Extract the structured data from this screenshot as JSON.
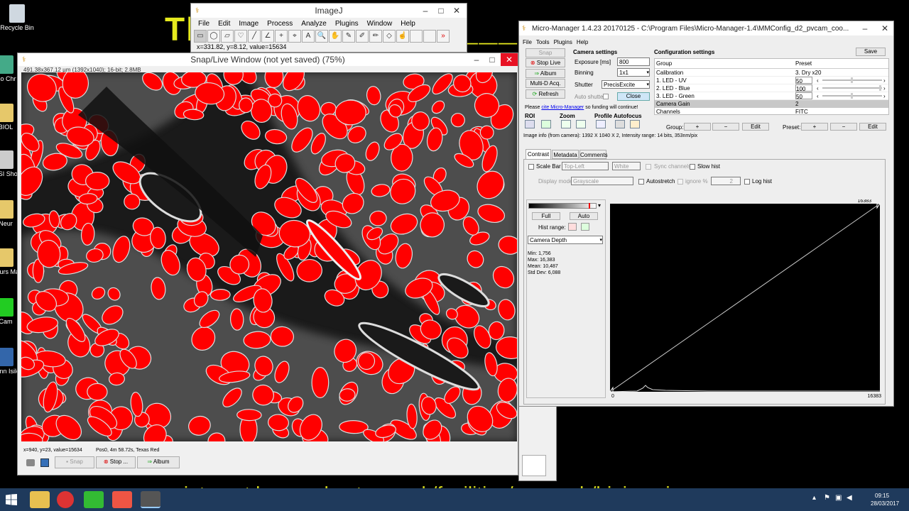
{
  "banner": {
    "top_text": "Thr__ ___ ___ __ ___ ____ ___",
    "bottom_text": "www.intranet.ls.manchester.ac.uk/facilities/research/bioimaging"
  },
  "desktop": {
    "icons": [
      {
        "label": "Recycle Bin"
      },
      {
        "label": "Go Chr"
      },
      {
        "label": "BIOL"
      },
      {
        "label": "RSI Sho"
      },
      {
        "label": "Neur"
      },
      {
        "label": "Thurs Ma"
      },
      {
        "label": "Cam"
      },
      {
        "label": "Conn Isilo"
      }
    ]
  },
  "imagej": {
    "title": "ImageJ",
    "menu": [
      "File",
      "Edit",
      "Image",
      "Process",
      "Analyze",
      "Plugins",
      "Window",
      "Help"
    ],
    "status": "x=331.82, y=8.12, value=15634",
    "tools": [
      "rectangle-tool",
      "oval-tool",
      "polygon-tool",
      "freehand-tool",
      "line-tool",
      "angle-tool",
      "point-tool",
      "wand-tool",
      "text-tool",
      "zoom-tool",
      "hand-tool",
      "dropper-tool",
      "pencil-tool",
      "brush-tool",
      "eraser-tool",
      "hand2-tool",
      "blank1",
      "blank2",
      "more-tool"
    ]
  },
  "snap": {
    "title": "Snap/Live Window (not yet saved) (75%)",
    "info": "491.38x367.12 µm (1392x1040); 16-bit; 2.8MB",
    "status_xy": "x=940, y=23, value=15634",
    "status_pos": "Pos0, 4m 58.72s, Texas Red",
    "buttons": {
      "snap": "Snap",
      "stop": "Stop ...",
      "album": "Album"
    }
  },
  "mm": {
    "title": "Micro-Manager 1.4.23 20170125 - C:\\Program Files\\Micro-Manager-1.4\\MMConfig_d2_pvcam_coo...",
    "menu": [
      "File",
      "Tools",
      "Plugins",
      "Help"
    ],
    "left_buttons": {
      "snap": "Snap",
      "stop_live": "Stop Live",
      "album": "Album",
      "multi_d": "Multi-D Acq.",
      "refresh": "Refresh"
    },
    "camera": {
      "heading": "Camera settings",
      "exposure_label": "Exposure [ms]",
      "exposure_value": "800",
      "binning_label": "Binning",
      "binning_value": "1x1",
      "shutter_label": "Shutter",
      "shutter_value": "PrecisExcite",
      "auto_shutter": "Auto shutter",
      "close": "Close"
    },
    "config": {
      "heading": "Configuration settings",
      "save": "Save",
      "col_group": "Group",
      "col_preset": "Preset",
      "rows": [
        {
          "group": "Calibration",
          "preset": "3. Dry x20"
        },
        {
          "group": "1. LED - UV",
          "preset": "50"
        },
        {
          "group": "2. LED - Blue",
          "preset": "100"
        },
        {
          "group": "3. LED - Green",
          "preset": "50"
        },
        {
          "group": "Camera Gain",
          "preset": "2"
        },
        {
          "group": "Channels",
          "preset": "FITC"
        }
      ],
      "group_label": "Group:",
      "preset_label": "Preset:",
      "plus": "+",
      "minus": "−",
      "edit": "Edit"
    },
    "cite_pre": "Please ",
    "cite_link": "cite Micro-Manager",
    "cite_post": " so funding will continue!",
    "tools": {
      "roi": "ROI",
      "zoom": "Zoom",
      "profile": "Profile",
      "autofocus": "Autofocus"
    },
    "image_info": "Image info (from camera): 1392 X 1040 X 2, Intensity range: 14 bits, 353nm/pix",
    "tabs": [
      "Contrast",
      "Metadata",
      "Comments"
    ],
    "contrast": {
      "scale_bar": "Scale Bar",
      "position": "Top-Left",
      "color": "White",
      "sync": "Sync channels",
      "slow_hist": "Slow hist",
      "display_mode_label": "Display mode:",
      "display_mode": "Grayscale",
      "autostretch": "Autostretch",
      "ignore": "ignore %",
      "ignore_val": "2",
      "log_hist": "Log hist",
      "full": "Full",
      "auto": "Auto",
      "hist_range": "Hist range:",
      "depth": "Camera Depth",
      "min": "Min: 1,756",
      "max": "Max: 16,383",
      "mean": "Mean: 10,487",
      "std": "Std Dev: 6,088",
      "hist_max": "16383",
      "hist_zero": "0",
      "hist_axis_max": "16383"
    }
  },
  "taskbar": {
    "time": "09:15",
    "date": "28/03/2017"
  },
  "colors": {
    "overlay": "#ff0000",
    "banner": "#e6ea1e",
    "taskbar": "#1f3a5c"
  }
}
